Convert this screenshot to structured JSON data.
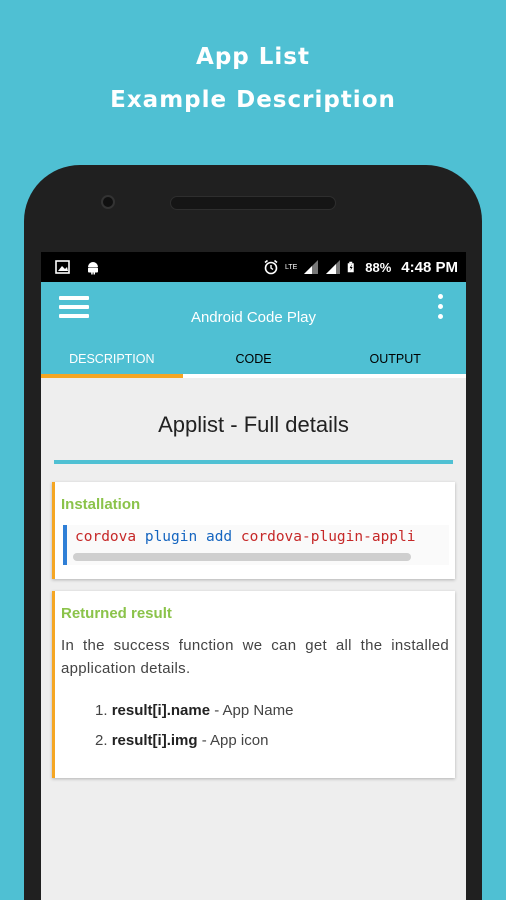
{
  "promo": {
    "line1": "App List",
    "line2": "Example Description"
  },
  "statusbar": {
    "left_icons": [
      "image-icon",
      "android-icon"
    ],
    "right_icons": [
      "alarm-icon",
      "lte-icon",
      "signal-icon",
      "signal-icon",
      "battery-icon"
    ],
    "lte_label": "LTE",
    "battery": "88%",
    "time": "4:48 PM"
  },
  "appbar": {
    "title": "Android Code Play",
    "accent_color": "#4fc0d3"
  },
  "tabs": [
    {
      "label": "DESCRIPTION",
      "active": true
    },
    {
      "label": "CODE",
      "active": false
    },
    {
      "label": "OUTPUT",
      "active": false
    }
  ],
  "page": {
    "heading": "Applist - Full details"
  },
  "installation": {
    "title": "Installation",
    "code_cmd": "cordova",
    "code_kw1": "plugin",
    "code_kw2": "add",
    "code_pkg": "cordova-plugin-appli"
  },
  "result": {
    "title": "Returned result",
    "text": "In the success function we can get all the installed application details.",
    "items": [
      {
        "num": "1.",
        "key": "result[i].name",
        "desc": " - App Name"
      },
      {
        "num": "2.",
        "key": "result[i].img",
        "desc": " - App icon"
      }
    ]
  }
}
